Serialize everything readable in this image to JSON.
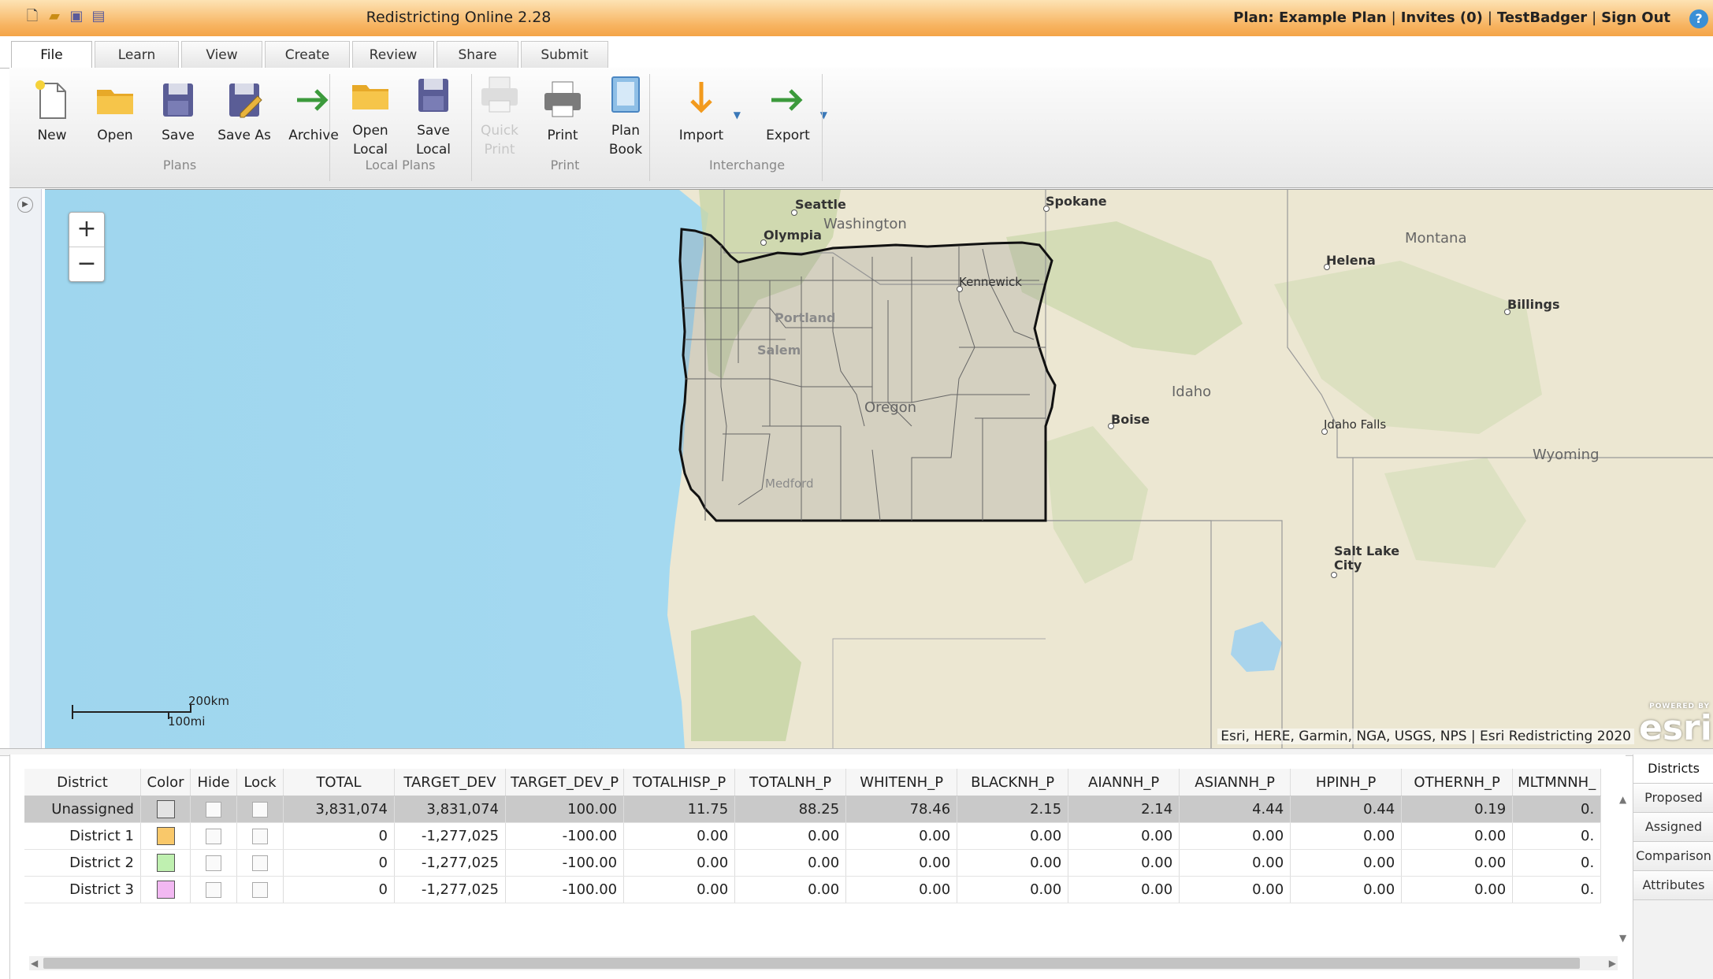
{
  "app": {
    "title": "Redistricting Online 2.28",
    "plan_label": "Plan: Example Plan",
    "invites": "Invites (0)",
    "user": "TestBadger",
    "sign_out": "Sign Out",
    "sep": "|"
  },
  "tabs": [
    "File",
    "Learn",
    "View",
    "Create",
    "Review",
    "Share",
    "Submit"
  ],
  "ribbon": {
    "new": "New",
    "open": "Open",
    "save": "Save",
    "save_as": "Save As",
    "archive": "Archive",
    "open_local_1": "Open",
    "open_local_2": "Local",
    "save_local_1": "Save",
    "save_local_2": "Local",
    "quick_print_1": "Quick",
    "quick_print_2": "Print",
    "print": "Print",
    "plan_book_1": "Plan",
    "plan_book_2": "Book",
    "import": "Import",
    "export": "Export",
    "groups": {
      "plans": "Plans",
      "local_plans": "Local Plans",
      "print": "Print",
      "interchange": "Interchange"
    }
  },
  "map": {
    "labels": {
      "seattle": "Seattle",
      "spokane": "Spokane",
      "washington": "Washington",
      "olympia": "Olympia",
      "montana": "Montana",
      "helena": "Helena",
      "kennewick": "Kennewick",
      "billings": "Billings",
      "portland": "Portland",
      "salem": "Salem",
      "oregon": "Oregon",
      "idaho": "Idaho",
      "boise": "Boise",
      "idaho_falls": "Idaho Falls",
      "wyoming": "Wyoming",
      "medford": "Medford",
      "salt_lake_1": "Salt Lake",
      "salt_lake_2": "City"
    },
    "zoom_in": "+",
    "zoom_out": "−",
    "scale_km": "200km",
    "scale_mi": "100mi",
    "attribution": "Esri, HERE, Garmin, NGA, USGS, NPS | Esri Redistricting 2020",
    "esri_small": "POWERED BY",
    "esri_logo": "esri"
  },
  "table": {
    "columns": [
      "District",
      "Color",
      "Hide",
      "Lock",
      "TOTAL",
      "TARGET_DEV",
      "TARGET_DEV_P",
      "TOTALHISP_P",
      "TOTALNH_P",
      "WHITENH_P",
      "BLACKNH_P",
      "AIANNH_P",
      "ASIANNH_P",
      "HPINH_P",
      "OTHERNH_P",
      "MLTMNNH_"
    ],
    "rows": [
      {
        "name": "Unassigned",
        "color": "#e3e3e3",
        "values": [
          "3,831,074",
          "3,831,074",
          "100.00",
          "11.75",
          "88.25",
          "78.46",
          "2.15",
          "2.14",
          "4.44",
          "0.44",
          "0.19",
          "0."
        ]
      },
      {
        "name": "District 1",
        "color": "#f9c86a",
        "values": [
          "0",
          "-1,277,025",
          "-100.00",
          "0.00",
          "0.00",
          "0.00",
          "0.00",
          "0.00",
          "0.00",
          "0.00",
          "0.00",
          "0."
        ]
      },
      {
        "name": "District 2",
        "color": "#bff0b0",
        "values": [
          "0",
          "-1,277,025",
          "-100.00",
          "0.00",
          "0.00",
          "0.00",
          "0.00",
          "0.00",
          "0.00",
          "0.00",
          "0.00",
          "0."
        ]
      },
      {
        "name": "District 3",
        "color": "#f2b8f2",
        "values": [
          "0",
          "-1,277,025",
          "-100.00",
          "0.00",
          "0.00",
          "0.00",
          "0.00",
          "0.00",
          "0.00",
          "0.00",
          "0.00",
          "0."
        ]
      }
    ]
  },
  "side_tabs": [
    "Districts",
    "Proposed",
    "Assigned",
    "Comparison",
    "Attributes"
  ]
}
